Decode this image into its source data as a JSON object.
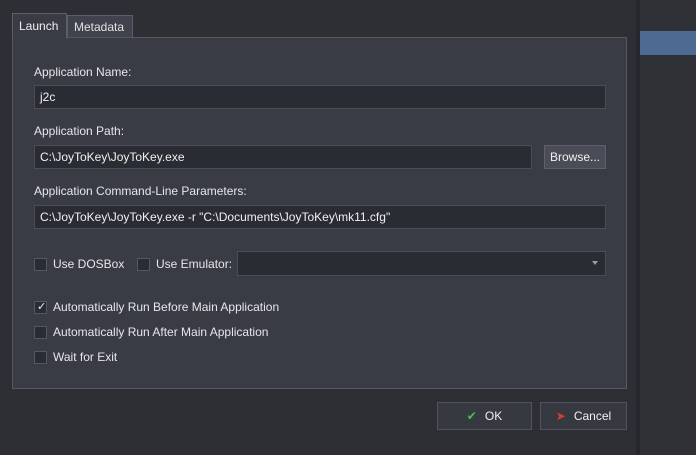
{
  "tabs": [
    {
      "label": "Launch",
      "active": true
    },
    {
      "label": "Metadata",
      "active": false
    }
  ],
  "form": {
    "app_name_label": "Application Name:",
    "app_name_value": "j2c",
    "app_path_label": "Application Path:",
    "app_path_value": "C:\\JoyToKey\\JoyToKey.exe",
    "browse_label": "Browse...",
    "cmdline_label": "Application Command-Line Parameters:",
    "cmdline_value": "C:\\JoyToKey\\JoyToKey.exe -r \"C:\\Documents\\JoyToKey\\mk11.cfg\"",
    "use_dosbox_label": "Use DOSBox",
    "use_dosbox_checked": false,
    "use_emulator_label": "Use Emulator:",
    "use_emulator_checked": false,
    "emulator_value": "",
    "auto_run_before_label": "Automatically Run Before Main Application",
    "auto_run_before_checked": true,
    "auto_run_after_label": "Automatically Run After Main Application",
    "auto_run_after_checked": false,
    "wait_for_exit_label": "Wait for Exit",
    "wait_for_exit_checked": false
  },
  "footer": {
    "ok_label": "OK",
    "cancel_label": "Cancel",
    "ok_icon": "checkmark-icon",
    "cancel_icon": "cancel-x-icon",
    "ok_icon_color": "#4bbf4b",
    "cancel_icon_color": "#d93a3a"
  },
  "colors": {
    "panel_bg": "#3a3c45",
    "input_bg": "#2a2c33",
    "accent_strip": "#4d6a93"
  }
}
